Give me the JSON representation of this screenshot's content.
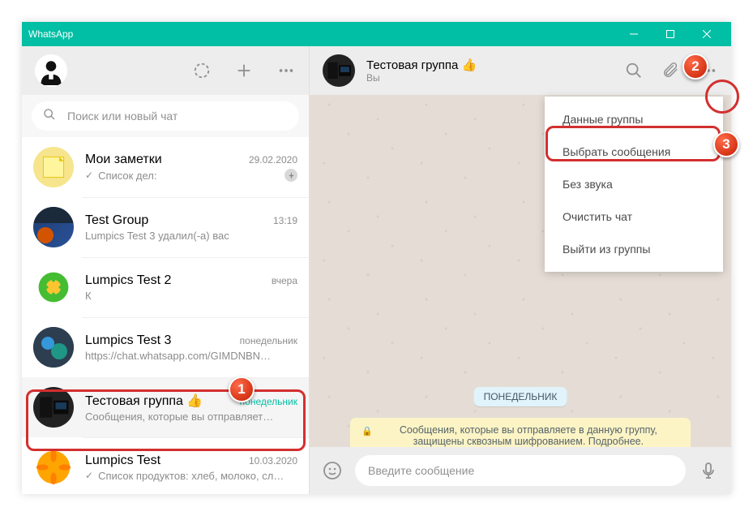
{
  "titlebar": {
    "title": "WhatsApp"
  },
  "search": {
    "placeholder": "Поиск или новый чат"
  },
  "chats": [
    {
      "name": "Мои заметки",
      "time": "29.02.2020",
      "preview": "Список дел:",
      "check": true,
      "pinned": true,
      "avatar_bg": "#f6e58d"
    },
    {
      "name": "Test Group",
      "time": "13:19",
      "preview": "Lumpics Test 3 удалил(-а) вас",
      "avatar_bg": "#2c3e50"
    },
    {
      "name": "Lumpics Test 2",
      "time": "вчера",
      "preview": "К",
      "avatar_bg": "#7bed9f"
    },
    {
      "name": "Lumpics Test 3",
      "time": "понедельник",
      "preview": "https://chat.whatsapp.com/GIMDNBN…",
      "avatar_bg": "#4b6584"
    },
    {
      "name": "Тестовая группа 👍",
      "time": "понедельник",
      "preview": "Сообщения, которые вы отправляет…",
      "selected": true,
      "avatar_bg": "#2d2d2d"
    },
    {
      "name": "Lumpics Test",
      "time": "10.03.2020",
      "preview": "Список продуктов: хлеб, молоко, сл…",
      "check": true,
      "avatar_bg": "#ffa502"
    }
  ],
  "main_header": {
    "name": "Тестовая группа 👍",
    "sub": "Вы"
  },
  "date_chip": "ПОНЕДЕЛЬНИК",
  "encryption_notice": "Сообщения, которые вы отправляете в данную группу, защищены сквозным шифрованием. Подробнее.",
  "composer": {
    "placeholder": "Введите сообщение"
  },
  "dropdown": {
    "items": [
      "Данные группы",
      "Выбрать сообщения",
      "Без звука",
      "Очистить чат",
      "Выйти из группы"
    ]
  },
  "callouts": {
    "c1": "1",
    "c2": "2",
    "c3": "3"
  }
}
